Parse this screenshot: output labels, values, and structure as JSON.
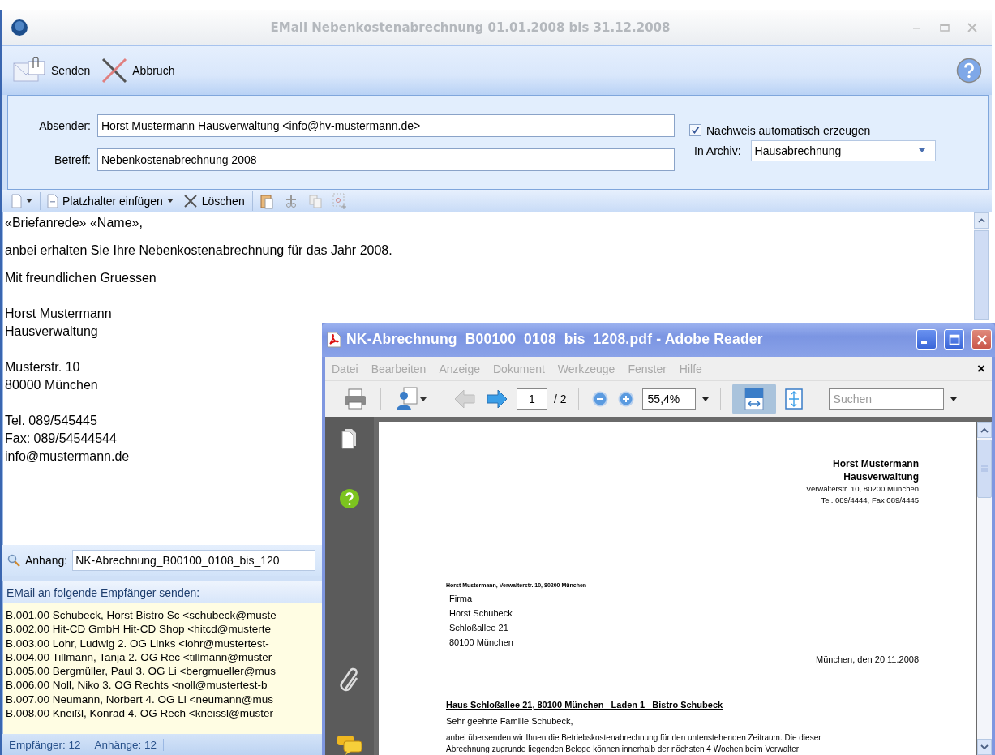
{
  "window": {
    "title": "EMail Nebenkostenabrechnung 01.01.2008 bis 31.12.2008"
  },
  "toolbar": [
    {
      "kind": "send",
      "label": "Senden"
    },
    {
      "kind": "cancel",
      "label": "Abbruch"
    }
  ],
  "form": {
    "sender_label": "Absender:",
    "sender": "Horst Mustermann Hausverwaltung <info@hv-mustermann.de>",
    "subject_label": "Betreff:",
    "subject": "Nebenkostenabrechnung 2008",
    "proof": {
      "label": "Nachweis automatisch erzeugen",
      "checked": true
    },
    "archive_label": "In Archiv:",
    "archive": "Hausabrechnung"
  },
  "editor_toolbar": [
    {
      "kind": "new"
    },
    {
      "kind": "placeholder",
      "label": "Platzhalter einfügen"
    },
    {
      "kind": "delete",
      "label": "Löschen"
    },
    {
      "kind": "paste"
    },
    {
      "kind": "cut"
    },
    {
      "kind": "copy"
    },
    {
      "kind": "field"
    }
  ],
  "body": {
    "paragraphs": [
      [
        "«Briefanrede» «Name»,"
      ],
      [
        "anbei erhalten Sie Ihre Nebenkostenabrechnung für das Jahr 2008."
      ],
      [
        "Mit freundlichen Gruessen"
      ],
      [
        "Horst Mustermann",
        "Hausverwaltung"
      ],
      [
        "Musterstr. 10",
        "80000 München"
      ],
      [
        "Tel. 089/545445",
        "Fax: 089/54544544",
        "info@mustermann.de"
      ]
    ]
  },
  "attachment": {
    "label": "Anhang:",
    "value": "NK-Abrechnung_B00100_0108_bis_120"
  },
  "recipients": {
    "title": "EMail an folgende Empfänger senden:",
    "items": [
      "B.001.00 Schubeck, Horst Bistro Sc <schubeck@muste",
      "B.002.00 Hit-CD GmbH Hit-CD Shop <hitcd@musterte",
      "B.003.00 Lohr, Ludwig 2. OG Links <lohr@mustertest-",
      "B.004.00 Tillmann, Tanja 2. OG Rec <tillmann@muster",
      "B.005.00 Bergmüller, Paul 3. OG Li <bergmueller@mus",
      "B.006.00 Noll, Niko 3. OG Rechts <noll@mustertest-b",
      "B.007.00 Neumann, Norbert 4. OG Li <neumann@mus",
      "B.008.00 Kneißl, Konrad 4. OG Rech <kneissl@muster"
    ]
  },
  "status_bar": [
    "Empfänger: 12",
    "Anhänge: 12"
  ],
  "reader": {
    "title": "NK-Abrechnung_B00100_0108_bis_1208.pdf - Adobe Reader",
    "menu": [
      "Datei",
      "Bearbeiten",
      "Anzeige",
      "Dokument",
      "Werkzeuge",
      "Fenster",
      "Hilfe"
    ],
    "menu_close": "×",
    "toolbar": {
      "page": "1",
      "page_count": "/ 2",
      "zoom": "55,4%",
      "search_placeholder": "Suchen",
      "prev_disabled": true,
      "fit_width_selected": true
    },
    "document": {
      "letterhead": [
        "Horst Mustermann",
        "Hausverwaltung"
      ],
      "letterhead_details": [
        "Verwalterstr. 10, 80200 München",
        "Tel. 089/4444, Fax 089/4445"
      ],
      "return_address": "Horst Mustermann, Verwalterstr. 10, 80200 München",
      "address": [
        "Firma",
        "Horst Schubeck",
        "Schloßallee 21",
        "80100 München"
      ],
      "date": "München, den 20.11.2008",
      "subject": "Haus Schloßallee 21, 80100 München   Laden 1   Bistro Schubeck",
      "salutation": "Sehr geehrte Familie Schubeck,",
      "text": [
        "anbei übersenden wir Ihnen die Betriebskostenabrechnung für den untenstehenden Zeitraum. Die dieser",
        "Abrechnung zugrunde liegenden Belege können innerhalb der nächsten 4 Wochen beim Verwalter"
      ]
    }
  }
}
